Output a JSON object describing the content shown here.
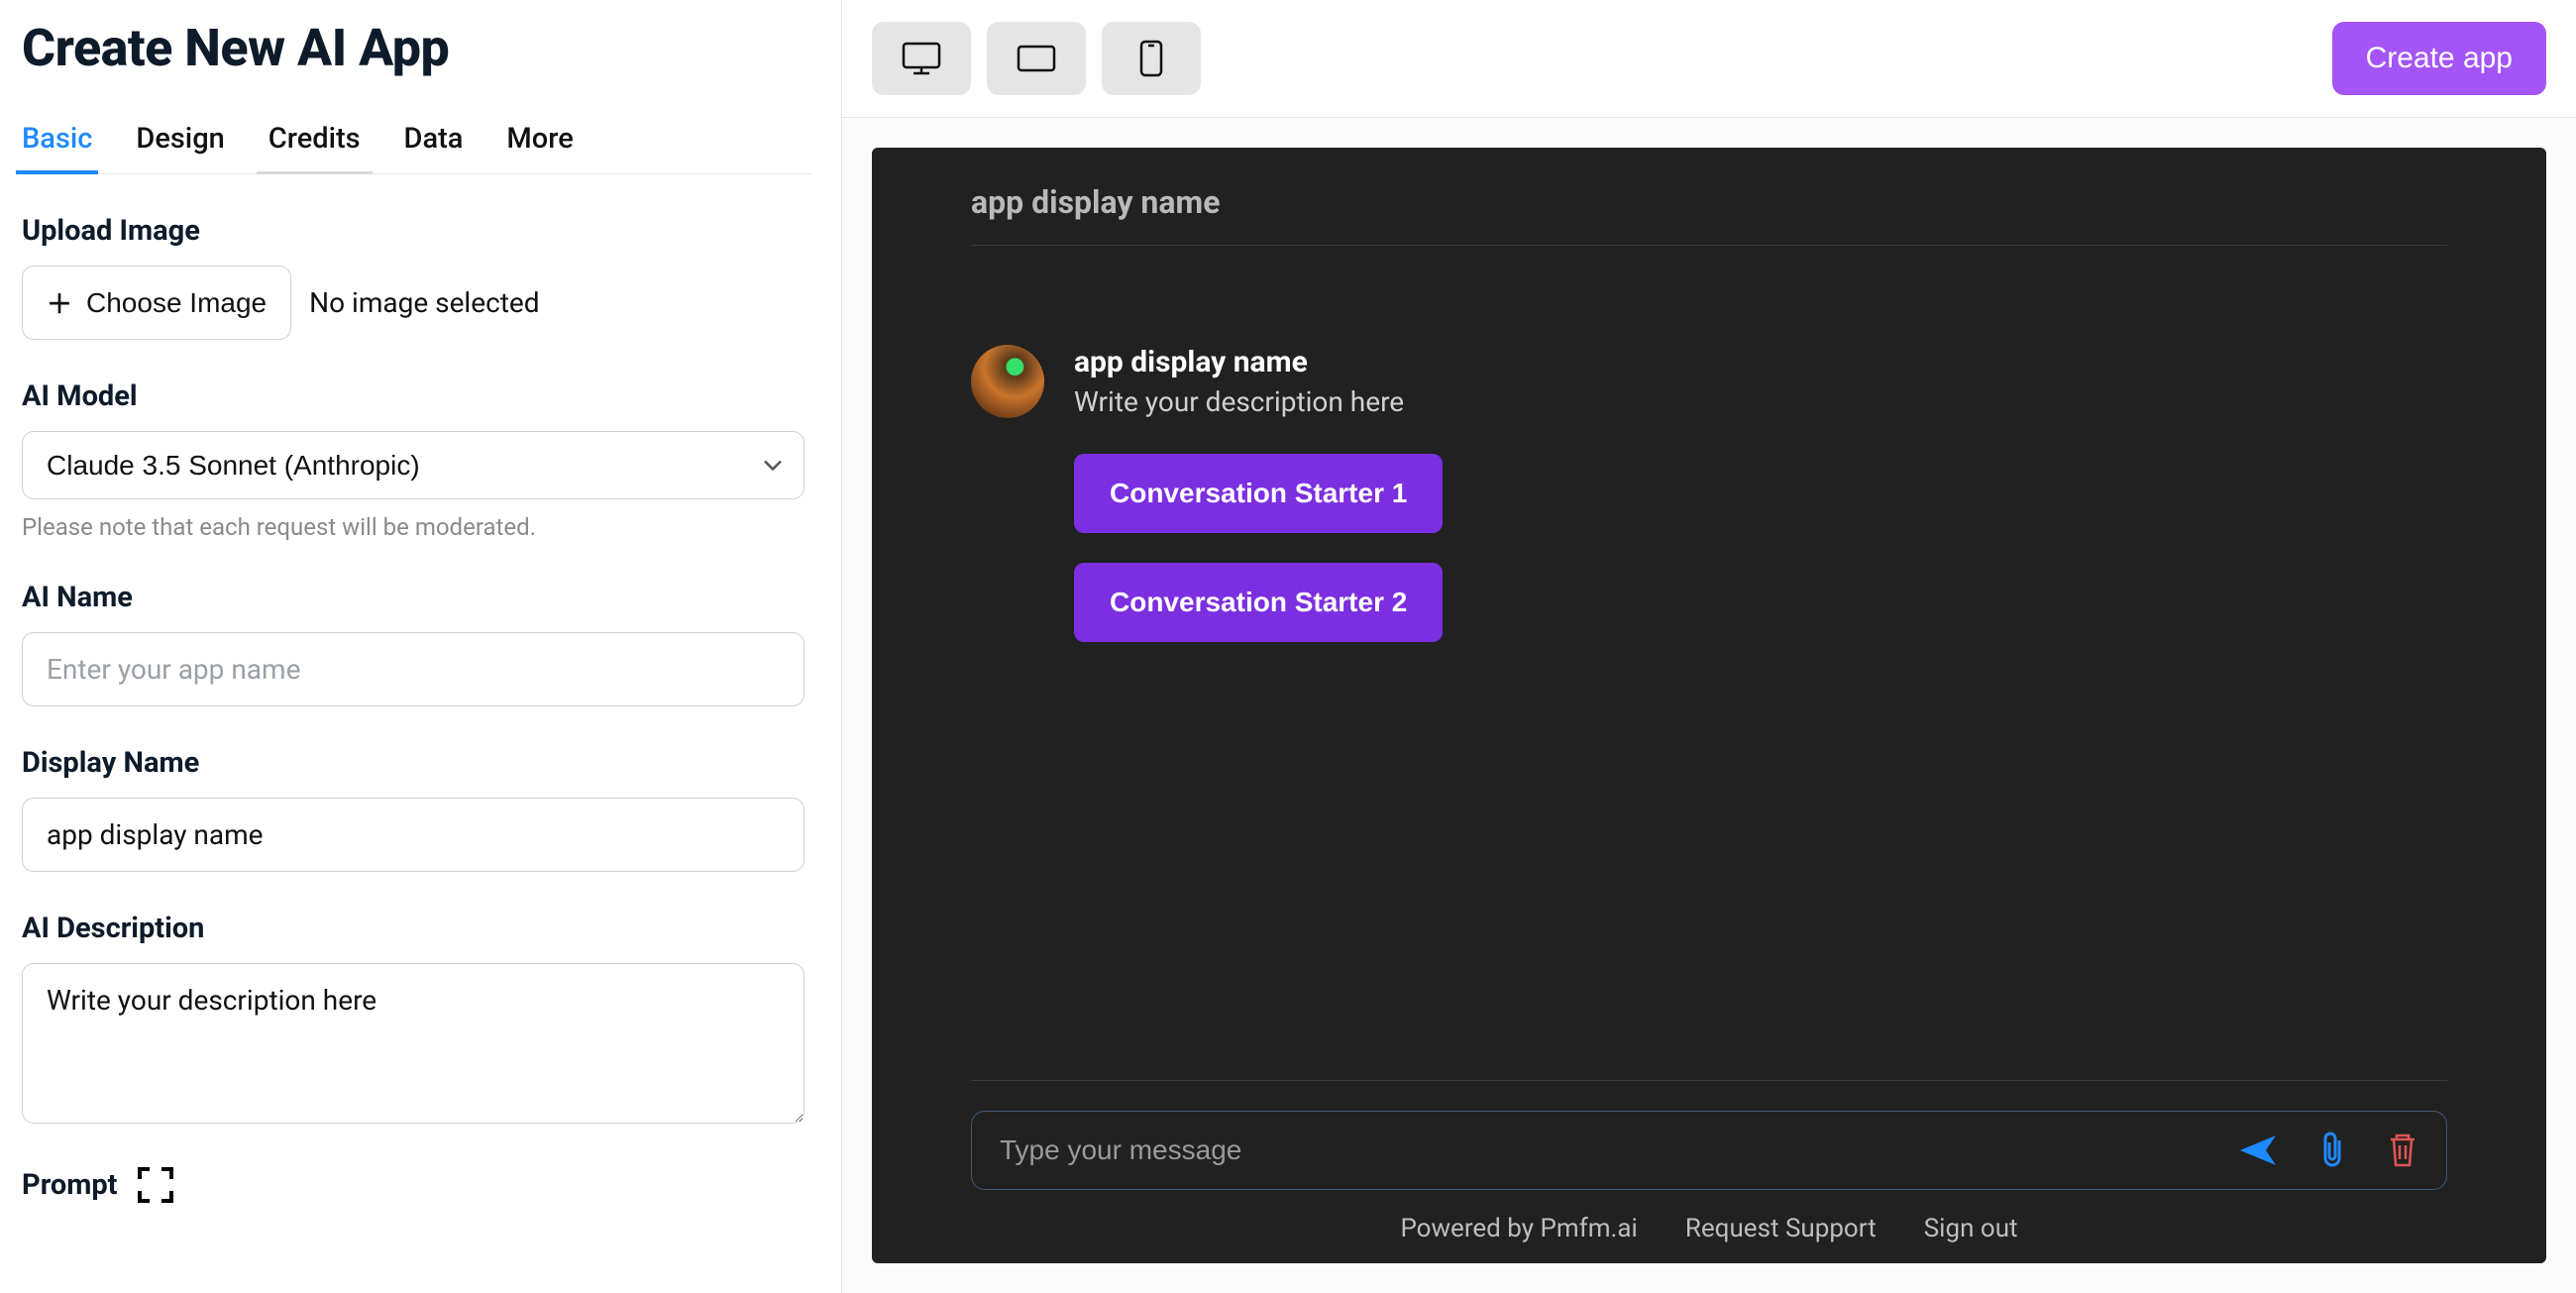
{
  "page_title": "Create New AI App",
  "tabs": [
    "Basic",
    "Design",
    "Credits",
    "Data",
    "More"
  ],
  "active_tab_index": 0,
  "underline_tab_index": 2,
  "upload": {
    "label": "Upload Image",
    "button": "Choose Image",
    "status": "No image selected"
  },
  "model": {
    "label": "AI Model",
    "selected": "Claude 3.5 Sonnet (Anthropic)",
    "help": "Please note that each request will be moderated."
  },
  "ai_name": {
    "label": "AI Name",
    "placeholder": "Enter your app name",
    "value": ""
  },
  "display_name": {
    "label": "Display Name",
    "value": "app display name"
  },
  "description": {
    "label": "AI Description",
    "value": "Write your description here"
  },
  "prompt": {
    "label": "Prompt"
  },
  "toolbar": {
    "create_app": "Create app"
  },
  "preview": {
    "header": "app display name",
    "app_name": "app display name",
    "app_desc": "Write your description here",
    "starters": [
      "Conversation Starter 1",
      "Conversation Starter 2"
    ],
    "chat_placeholder": "Type your message"
  },
  "footer": {
    "powered": "Powered by Pmfm.ai",
    "support": "Request Support",
    "signout": "Sign out"
  }
}
